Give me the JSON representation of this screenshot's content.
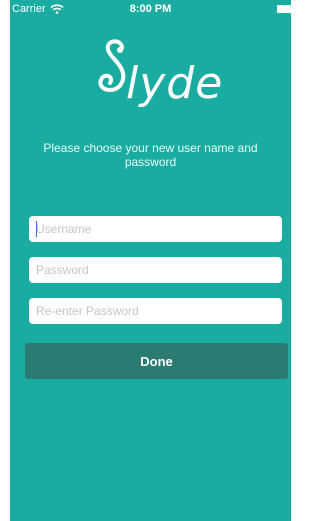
{
  "status_bar": {
    "carrier": "Carrier",
    "time": "8:00 PM",
    "wifi_icon": "wifi-icon",
    "battery_icon": "battery-icon"
  },
  "logo": {
    "text": "lyde",
    "letter": "S"
  },
  "subtitle": "Please choose your new user name and password",
  "form": {
    "username_placeholder": "Username",
    "username_value": "",
    "password_placeholder": "Password",
    "password_value": "",
    "reenter_placeholder": "Re-enter Password",
    "reenter_value": ""
  },
  "done_label": "Done",
  "colors": {
    "background": "#1aaca1",
    "button": "#2b7b73",
    "text": "#ffffff"
  }
}
